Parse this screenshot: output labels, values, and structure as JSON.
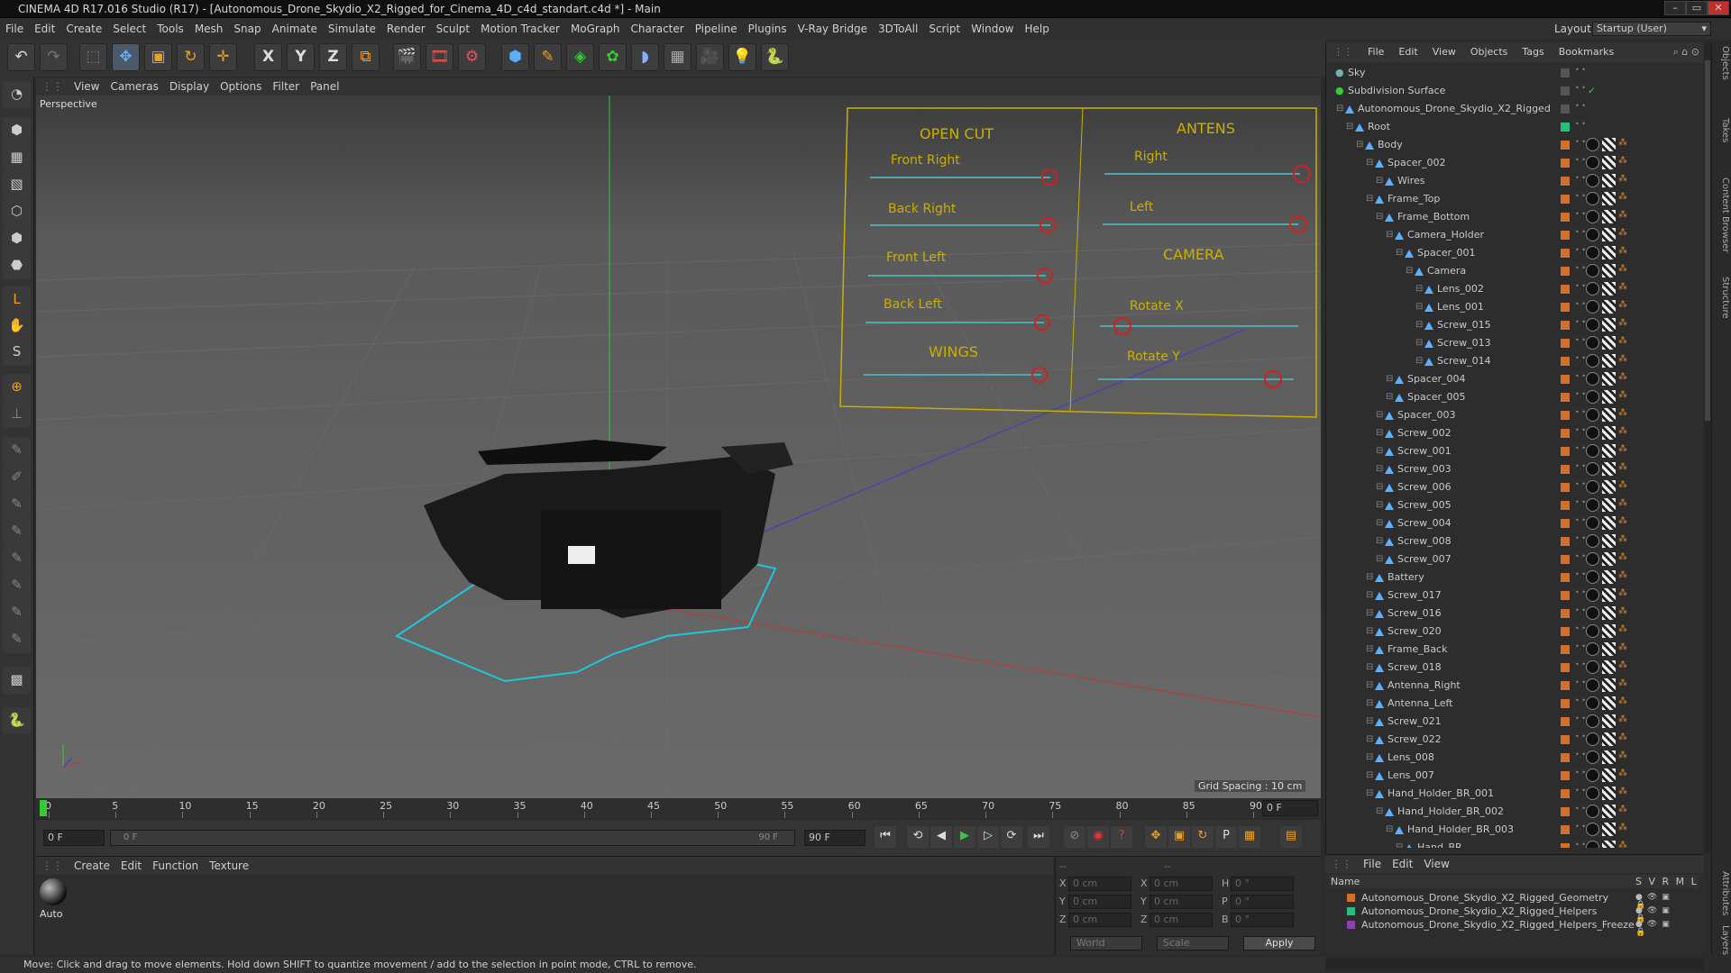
{
  "window": {
    "title": "CINEMA 4D R17.016 Studio (R17) - [Autonomous_Drone_Skydio_X2_Rigged_for_Cinema_4D_c4d_standart.c4d *] - Main",
    "minimize": "–",
    "maximize": "▭",
    "close": "✕"
  },
  "menubar": {
    "items": [
      "File",
      "Edit",
      "Create",
      "Select",
      "Tools",
      "Mesh",
      "Snap",
      "Animate",
      "Simulate",
      "Render",
      "Sculpt",
      "Motion Tracker",
      "MoGraph",
      "Character",
      "Pipeline",
      "Plugins",
      "V-Ray Bridge",
      "3DToAll",
      "Script",
      "Window",
      "Help"
    ],
    "layout_label": "Layout:",
    "layout_value": "Startup (User)"
  },
  "toolbar": {
    "icons": [
      "undo-icon",
      "redo-icon",
      "live-selection-icon",
      "move-icon",
      "scale-icon",
      "rotate-icon",
      "multi-tool-icon",
      "x-axis-icon",
      "y-axis-icon",
      "z-axis-icon",
      "world-coordinate-icon",
      "render-view-icon",
      "render-picture-viewer-icon",
      "edit-render-settings-icon",
      "cube-icon",
      "pen-icon",
      "subdivision-icon",
      "cloner-icon",
      "deformer-icon",
      "floor-icon",
      "camera-icon",
      "light-icon",
      "python-icon"
    ],
    "axis_x": "X",
    "axis_y": "Y",
    "axis_z": "Z"
  },
  "viewport": {
    "menu": [
      "View",
      "Cameras",
      "Display",
      "Options",
      "Filter",
      "Panel"
    ],
    "label": "Perspective",
    "grid_spacing": "Grid Spacing : 10 cm",
    "rig_panel": {
      "open_cut": "OPEN CUT",
      "antens": "ANTENS",
      "camera": "CAMERA",
      "wings": "WINGS",
      "front_right": "Front Right",
      "back_right": "Back Right",
      "front_left": "Front Left",
      "back_left": "Back Left",
      "right": "Right",
      "left": "Left",
      "rotate_x": "Rotate X",
      "rotate_y": "Rotate Y"
    }
  },
  "timeline": {
    "ticks": [
      "0",
      "5",
      "10",
      "15",
      "20",
      "25",
      "30",
      "35",
      "40",
      "45",
      "50",
      "55",
      "60",
      "65",
      "70",
      "75",
      "80",
      "85",
      "90"
    ],
    "current_frame_right": "0 F",
    "start_field": "0 F",
    "range_start": "0 F",
    "range_end": "90 F",
    "end_field": "90 F",
    "playhead_fraction": 0.0
  },
  "material_manager": {
    "menu": [
      "Create",
      "Edit",
      "Function",
      "Texture"
    ],
    "material_name": "Auto"
  },
  "coordinates": {
    "rows": [
      {
        "a": "X",
        "av": "0 cm",
        "b": "X",
        "bv": "0 cm",
        "c": "H",
        "cv": "0 °"
      },
      {
        "a": "Y",
        "av": "0 cm",
        "b": "Y",
        "bv": "0 cm",
        "c": "P",
        "cv": "0 °"
      },
      {
        "a": "Z",
        "av": "0 cm",
        "b": "Z",
        "bv": "0 cm",
        "c": "B",
        "cv": "0 °"
      }
    ],
    "mode": "World",
    "scale": "Scale",
    "apply": "Apply",
    "header_a": "--",
    "header_b": "--"
  },
  "status": "Move: Click and drag to move elements. Hold down SHIFT to quantize movement / add to the selection in point mode, CTRL to remove.",
  "object_manager": {
    "menu": [
      "File",
      "Edit",
      "View",
      "Objects",
      "Tags",
      "Bookmarks"
    ],
    "objects": [
      {
        "name": "Sky",
        "depth": 0
      },
      {
        "name": "Subdivision Surface",
        "depth": 0
      },
      {
        "name": "Autonomous_Drone_Skydio_X2_Rigged",
        "depth": 1
      },
      {
        "name": "Root",
        "depth": 2
      },
      {
        "name": "Body",
        "depth": 3
      },
      {
        "name": "Spacer_002",
        "depth": 4
      },
      {
        "name": "Wires",
        "depth": 5
      },
      {
        "name": "Frame_Top",
        "depth": 4
      },
      {
        "name": "Frame_Bottom",
        "depth": 5
      },
      {
        "name": "Camera_Holder",
        "depth": 6
      },
      {
        "name": "Spacer_001",
        "depth": 7
      },
      {
        "name": "Camera",
        "depth": 8
      },
      {
        "name": "Lens_002",
        "depth": 9
      },
      {
        "name": "Lens_001",
        "depth": 9
      },
      {
        "name": "Screw_015",
        "depth": 9
      },
      {
        "name": "Screw_013",
        "depth": 9
      },
      {
        "name": "Screw_014",
        "depth": 9
      },
      {
        "name": "Spacer_004",
        "depth": 6
      },
      {
        "name": "Spacer_005",
        "depth": 6
      },
      {
        "name": "Spacer_003",
        "depth": 5
      },
      {
        "name": "Screw_002",
        "depth": 5
      },
      {
        "name": "Screw_001",
        "depth": 5
      },
      {
        "name": "Screw_003",
        "depth": 5
      },
      {
        "name": "Screw_006",
        "depth": 5
      },
      {
        "name": "Screw_005",
        "depth": 5
      },
      {
        "name": "Screw_004",
        "depth": 5
      },
      {
        "name": "Screw_008",
        "depth": 5
      },
      {
        "name": "Screw_007",
        "depth": 5
      },
      {
        "name": "Battery",
        "depth": 4
      },
      {
        "name": "Screw_017",
        "depth": 4
      },
      {
        "name": "Screw_016",
        "depth": 4
      },
      {
        "name": "Screw_020",
        "depth": 4
      },
      {
        "name": "Frame_Back",
        "depth": 4
      },
      {
        "name": "Screw_018",
        "depth": 4
      },
      {
        "name": "Antenna_Right",
        "depth": 4
      },
      {
        "name": "Antenna_Left",
        "depth": 4
      },
      {
        "name": "Screw_021",
        "depth": 4
      },
      {
        "name": "Screw_022",
        "depth": 4
      },
      {
        "name": "Lens_008",
        "depth": 4
      },
      {
        "name": "Lens_007",
        "depth": 4
      },
      {
        "name": "Hand_Holder_BR_001",
        "depth": 4
      },
      {
        "name": "Hand_Holder_BR_002",
        "depth": 5
      },
      {
        "name": "Hand_Holder_BR_003",
        "depth": 6
      },
      {
        "name": "Hand_BR",
        "depth": 7
      }
    ]
  },
  "layer_manager": {
    "menu": [
      "File",
      "Edit",
      "View"
    ],
    "col_name": "Name",
    "cols": "S V R M L",
    "layers": [
      {
        "name": "Autonomous_Drone_Skydio_X2_Rigged_Geometry",
        "color": "#d0722d"
      },
      {
        "name": "Autonomous_Drone_Skydio_X2_Rigged_Helpers",
        "color": "#22c07a"
      },
      {
        "name": "Autonomous_Drone_Skydio_X2_Rigged_Helpers_Freeze",
        "color": "#8844aa"
      }
    ]
  },
  "side_tabs": [
    "Objects",
    "Takes",
    "Content Browser",
    "Structure",
    "Attributes",
    "Layers"
  ],
  "left_tools": [
    "make-editable-icon",
    "model-mode-icon",
    "texture-mode-icon",
    "workplane-icon",
    "points-mode-icon",
    "edges-mode-icon",
    "polygons-mode-icon",
    "axis-mode-icon",
    "tweak-icon",
    "solo-icon",
    "magnet-icon",
    "snap-icon",
    "brush-icon",
    "grab-icon",
    "smooth-icon",
    "pull-icon",
    "flatten-icon",
    "inflate-icon",
    "pinch-icon",
    "wax-icon",
    "mask-icon",
    "python-icon"
  ]
}
